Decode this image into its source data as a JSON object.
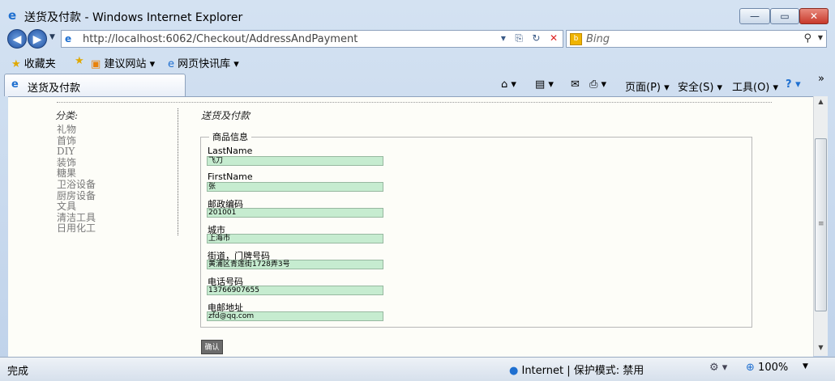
{
  "window": {
    "title": "送货及付款 - Windows Internet Explorer",
    "min_label": "—",
    "max_label": "▭",
    "close_label": "✕"
  },
  "address": {
    "url": "http://localhost:6062/Checkout/AddressAndPayment",
    "search_placeholder": "Bing"
  },
  "favorites": {
    "favorites_label": "收藏夹",
    "suggested_sites": "建议网站 ▾",
    "web_slice": "网页快讯库 ▾"
  },
  "tab": {
    "label": "送货及付款"
  },
  "commands": {
    "page": "页面(P) ▾",
    "safety": "安全(S) ▾",
    "tools": "工具(O) ▾",
    "help": "? ▾",
    "more": "»"
  },
  "sidebar": {
    "title": "分类:",
    "items": [
      "礼物",
      "首饰",
      "DIY",
      "装饰",
      "糖果",
      "卫浴设备",
      "厨房设备",
      "文具",
      "清洁工具",
      "日用化工"
    ]
  },
  "main": {
    "heading": "送货及付款",
    "legend": "商品信息",
    "fields": [
      {
        "label": "LastName",
        "value": "飞刀"
      },
      {
        "label": "FirstName",
        "value": "张"
      },
      {
        "label": "邮政编码",
        "value": "201001"
      },
      {
        "label": "城市",
        "value": "上海市"
      },
      {
        "label": "街道，门牌号码",
        "value": "黄浦区青莲街1728弄3号"
      },
      {
        "label": "电话号码",
        "value": "13766907655"
      },
      {
        "label": "电邮地址",
        "value": "zfd@qq.com"
      }
    ],
    "submit_label": "确认"
  },
  "status": {
    "text": "完成",
    "zone": "Internet | 保护模式: 禁用",
    "zoom": "100%"
  }
}
